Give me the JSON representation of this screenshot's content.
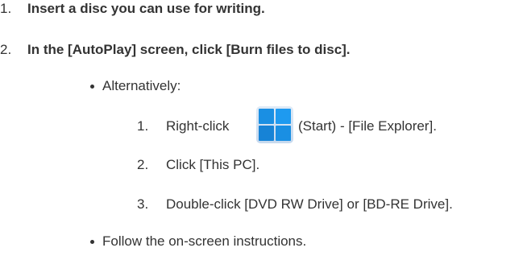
{
  "steps": [
    {
      "number": "1.",
      "text": "Insert a disc you can use for writing."
    },
    {
      "number": "2.",
      "text": "In the [AutoPlay] screen, click [Burn files to disc]."
    }
  ],
  "bullets": [
    {
      "text": "Alternatively:"
    },
    {
      "text": "Follow the on-screen instructions."
    }
  ],
  "substeps": [
    {
      "number": "1.",
      "text_before_icon": "Right-click",
      "icon": "windows-start-icon",
      "text_after_icon": "(Start) - [File Explorer]."
    },
    {
      "number": "2.",
      "text": "Click [This PC]."
    },
    {
      "number": "3.",
      "text": "Double-click [DVD RW Drive] or [BD-RE Drive]."
    }
  ],
  "colors": {
    "text": "#333333",
    "icon_tiles": "#1a8fe3"
  }
}
